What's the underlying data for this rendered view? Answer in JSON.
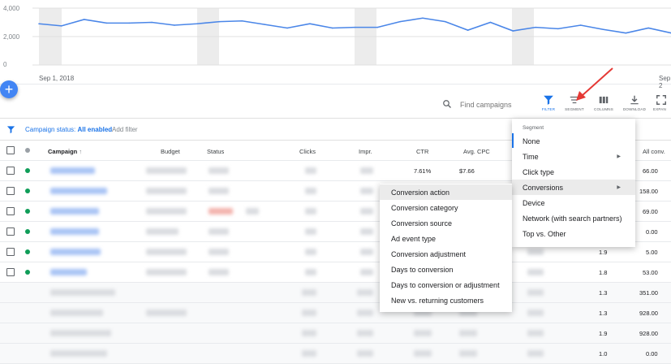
{
  "chart": {
    "y_ticks": [
      "4,000",
      "2,000",
      "0"
    ],
    "x_ticks": [
      "Sep 1, 2018",
      "Sep 2"
    ],
    "line_color": "#4a86e8",
    "values": [
      2900,
      2750,
      3200,
      2950,
      2950,
      3000,
      2800,
      2900,
      3050,
      3100,
      2850,
      2600,
      2900,
      2600,
      2650,
      2650,
      3050,
      3300,
      3050,
      2450,
      3000,
      2400,
      2650,
      2550,
      2800,
      2500,
      2250,
      2600,
      2250
    ]
  },
  "fab": {
    "label": "+"
  },
  "toolbar": {
    "search_placeholder": "Find campaigns",
    "filter_label": "FILTER",
    "segment_label": "SEGMENT",
    "columns_label": "COLUMNS",
    "download_label": "DOWNLOAD",
    "expand_label": "EXPAN"
  },
  "filter": {
    "status_prefix": "Campaign status: ",
    "status_value": "All enabled",
    "add_filter": "Add filter"
  },
  "table": {
    "headers": {
      "campaign": "Campaign",
      "budget": "Budget",
      "status": "Status",
      "clicks": "Clicks",
      "impr": "Impr.",
      "ctr": "CTR",
      "avg_cpc": "Avg. CPC",
      "all_conv": "All conv."
    },
    "rows": [
      {
        "ctr": "7.61%",
        "avg_cpc": "$7.66",
        "conv_rate": "",
        "all_conv": "66.00"
      },
      {
        "ctr": "",
        "avg_cpc": "",
        "conv_rate": "",
        "all_conv": "158.00"
      },
      {
        "ctr": "",
        "avg_cpc": "",
        "conv_rate": "",
        "all_conv": "69.00"
      },
      {
        "ctr": "",
        "avg_cpc": "",
        "conv_rate": "",
        "all_conv": "0.00"
      },
      {
        "ctr": "",
        "avg_cpc": "",
        "conv_rate": "1.9",
        "all_conv": "5.00"
      },
      {
        "ctr": "",
        "avg_cpc": "",
        "conv_rate": "1.8",
        "all_conv": "53.00"
      }
    ],
    "summary_rows": [
      {
        "conv_rate": "1.3",
        "all_conv": "351.00"
      },
      {
        "conv_rate": "1.3",
        "all_conv": "928.00"
      },
      {
        "conv_rate": "1.9",
        "all_conv": "928.00"
      },
      {
        "conv_rate": "1.0",
        "all_conv": "0.00"
      }
    ]
  },
  "segment_menu": {
    "title": "Segment",
    "items": [
      {
        "label": "None"
      },
      {
        "label": "Time",
        "submenu": true
      },
      {
        "label": "Click type"
      },
      {
        "label": "Conversions",
        "submenu": true
      },
      {
        "label": "Device"
      },
      {
        "label": "Network (with search partners)"
      },
      {
        "label": "Top vs. Other"
      }
    ]
  },
  "conversions_submenu": {
    "items": [
      "Conversion action",
      "Conversion category",
      "Conversion source",
      "Ad event type",
      "Conversion adjustment",
      "Days to conversion",
      "Days to conversion or adjustment",
      "New vs. returning customers"
    ]
  },
  "colors": {
    "accent": "#1a73e8",
    "enabled_dot": "#0f9d58",
    "annotation_arrow": "#e53935"
  }
}
